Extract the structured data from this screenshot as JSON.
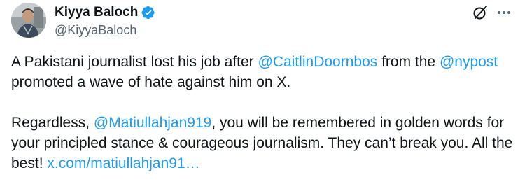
{
  "author": {
    "name": "Kiyya Baloch",
    "handle": "@KiyyaBaloch"
  },
  "icons": {
    "verified": "verified-badge-icon",
    "grok": "grok-icon",
    "more": "more-options-icon"
  },
  "colors": {
    "link": "#1d9bf0",
    "verified": "#1d9bf0",
    "text": "#0f1419",
    "secondary": "#536471"
  },
  "tweet": {
    "p1": {
      "t1": "A Pakistani journalist lost his job after ",
      "mention1": "@CaitlinDoornbos",
      "t2": " from the ",
      "mention2": "@nypost",
      "t3": " promoted a wave of hate against him on X."
    },
    "p2": {
      "t1": "Regardless, ",
      "mention1": "@Matiullahjan919",
      "t2": ", you will be remembered in golden words for your principled stance & courageous journalism. They can’t break you. All the best! ",
      "link": "x.com/matiullahjan91…"
    }
  }
}
